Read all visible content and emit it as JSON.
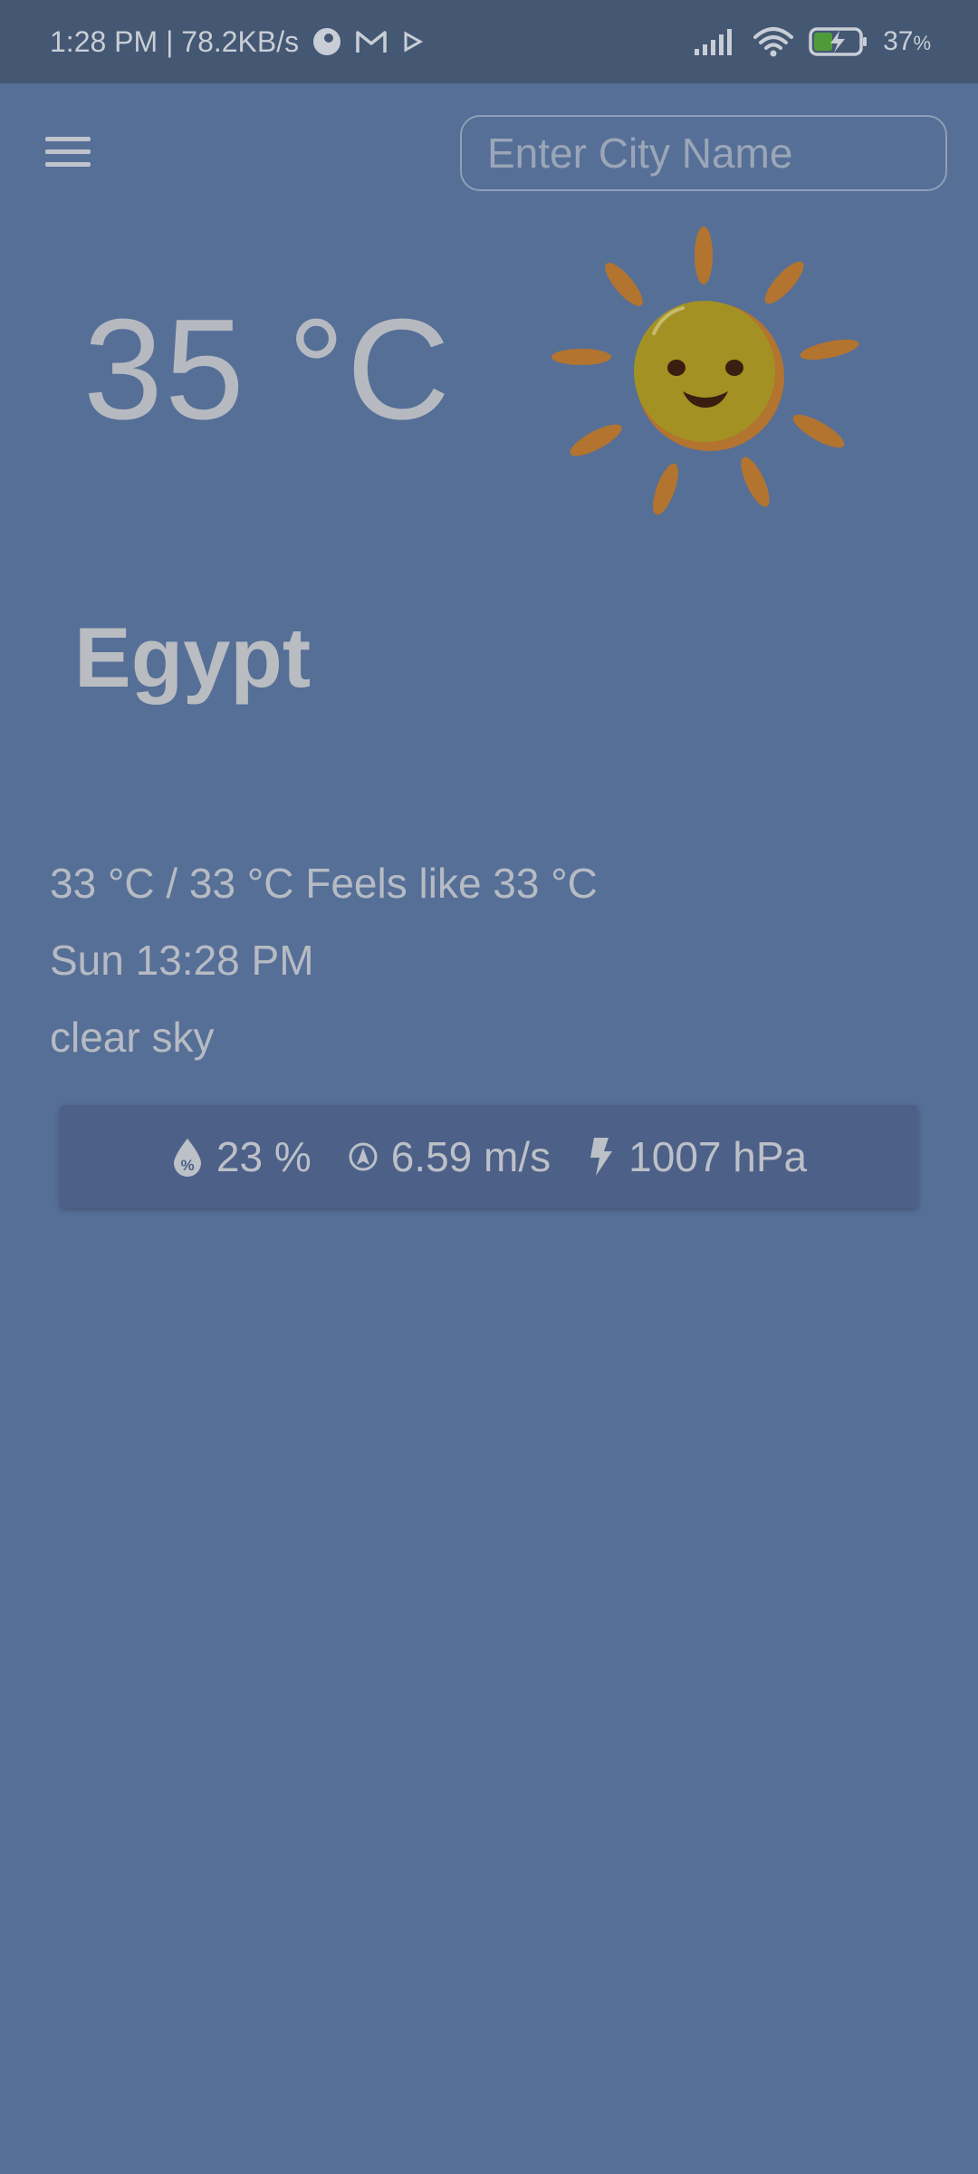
{
  "status_bar": {
    "time_speed": "1:28 PM | 78.2KB/s",
    "battery_percent": "37",
    "battery_unit": "%",
    "icons": [
      "settings-app-icon",
      "gmail-icon",
      "play-icon",
      "signal-icon",
      "wifi-icon",
      "battery-charging-icon"
    ]
  },
  "search": {
    "placeholder": "Enter City Name",
    "value": ""
  },
  "weather": {
    "temperature": "35 °C",
    "condition_icon": "sun-smiling-icon",
    "city": "Egypt",
    "minmax_feels": "33 °C / 33 °C Feels like 33 °C",
    "datetime": "Sun 13:28 PM",
    "description": "clear sky"
  },
  "stats": {
    "humidity": "23 %",
    "wind": "6.59 m/s",
    "pressure": "1007 hPa"
  },
  "colors": {
    "background": "#566f97",
    "status_bar": "#445773",
    "card": "#4c6088",
    "sun_face": "#a39223",
    "sun_rays": "#b3742f"
  }
}
